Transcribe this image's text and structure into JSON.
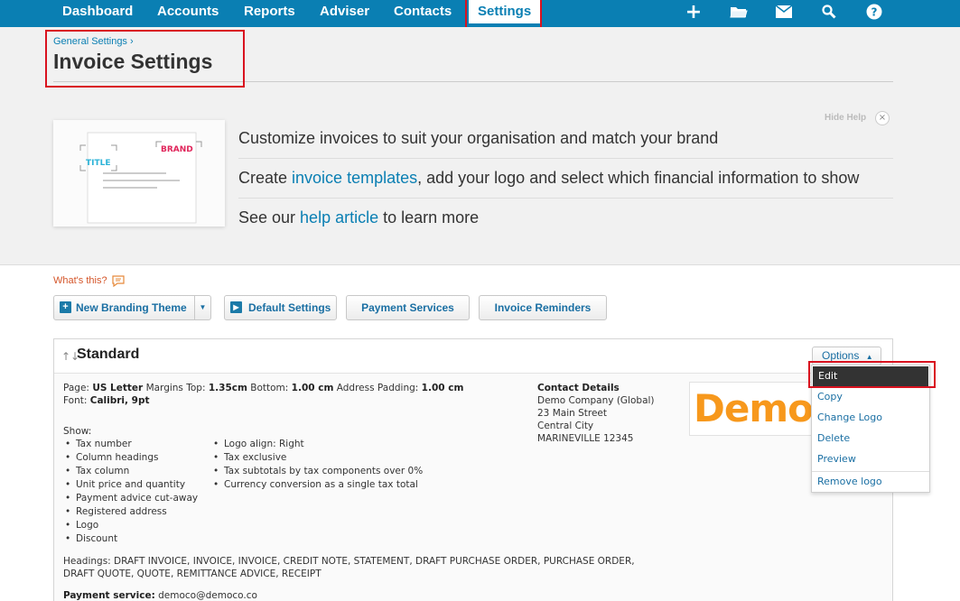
{
  "nav": {
    "items": [
      "Dashboard",
      "Accounts",
      "Reports",
      "Adviser",
      "Contacts",
      "Settings"
    ],
    "icons": [
      "plus-icon",
      "folder-icon",
      "mail-icon",
      "search-icon",
      "help-icon"
    ]
  },
  "header": {
    "breadcrumb": "General Settings",
    "breadcrumb_sep": "›",
    "title": "Invoice Settings"
  },
  "help": {
    "image_label_title": "TITLE",
    "image_label_brand": "BRAND",
    "line1": "Customize invoices to suit your organisation and match your brand",
    "line2_pre": "Create ",
    "line2_link": "invoice templates",
    "line2_post": ", add your logo and select which financial information to show",
    "line3_pre": "See our ",
    "line3_link": "help article",
    "line3_post": " to learn more",
    "hide_label": "Hide Help",
    "hide_x": "×"
  },
  "toolbar": {
    "whats_this": "What's this?",
    "new_branding": "New Branding Theme",
    "default_settings": "Default Settings",
    "payment_services": "Payment Services",
    "invoice_reminders": "Invoice Reminders"
  },
  "theme": {
    "title": "Standard",
    "page_label": "Page:",
    "page_value": "US Letter",
    "margins_top_label": "Margins Top:",
    "margins_top_value": "1.35cm",
    "bottom_label": "Bottom:",
    "bottom_value": "1.00 cm",
    "address_padding_label": "Address Padding:",
    "address_padding_value": "1.00 cm",
    "font_label": "Font:",
    "font_value": "Calibri, 9pt",
    "show_label": "Show:",
    "show_col1": [
      "Tax number",
      "Column headings",
      "Tax column",
      "Unit price and quantity",
      "Payment advice cut-away",
      "Registered address",
      "Logo",
      "Discount"
    ],
    "show_col2": [
      "Logo align: Right",
      "Tax exclusive",
      "Tax subtotals by tax components over 0%",
      "Currency conversion as a single tax total"
    ],
    "headings_line1": "Headings: DRAFT INVOICE, INVOICE, INVOICE, CREDIT NOTE, STATEMENT, DRAFT PURCHASE ORDER, PURCHASE ORDER,",
    "headings_line2": "DRAFT QUOTE, QUOTE, REMITTANCE ADVICE, RECEIPT",
    "payment_label": "Payment service:",
    "payment_value": "democo@democo.co",
    "contact_title": "Contact Details",
    "contact_lines": [
      "Demo Company (Global)",
      "23 Main Street",
      "Central City",
      "MARINEVILLE 12345"
    ],
    "logo_text": "Demo"
  },
  "options": {
    "label": "Options",
    "caret": "▲",
    "items": [
      "Edit",
      "Copy",
      "Change Logo",
      "Delete",
      "Preview",
      "Remove logo"
    ]
  },
  "colors": {
    "nav_bg": "#0a7fb3",
    "highlight": "#d9121f",
    "link": "#0a7fb3",
    "logo": "#f7981c"
  }
}
